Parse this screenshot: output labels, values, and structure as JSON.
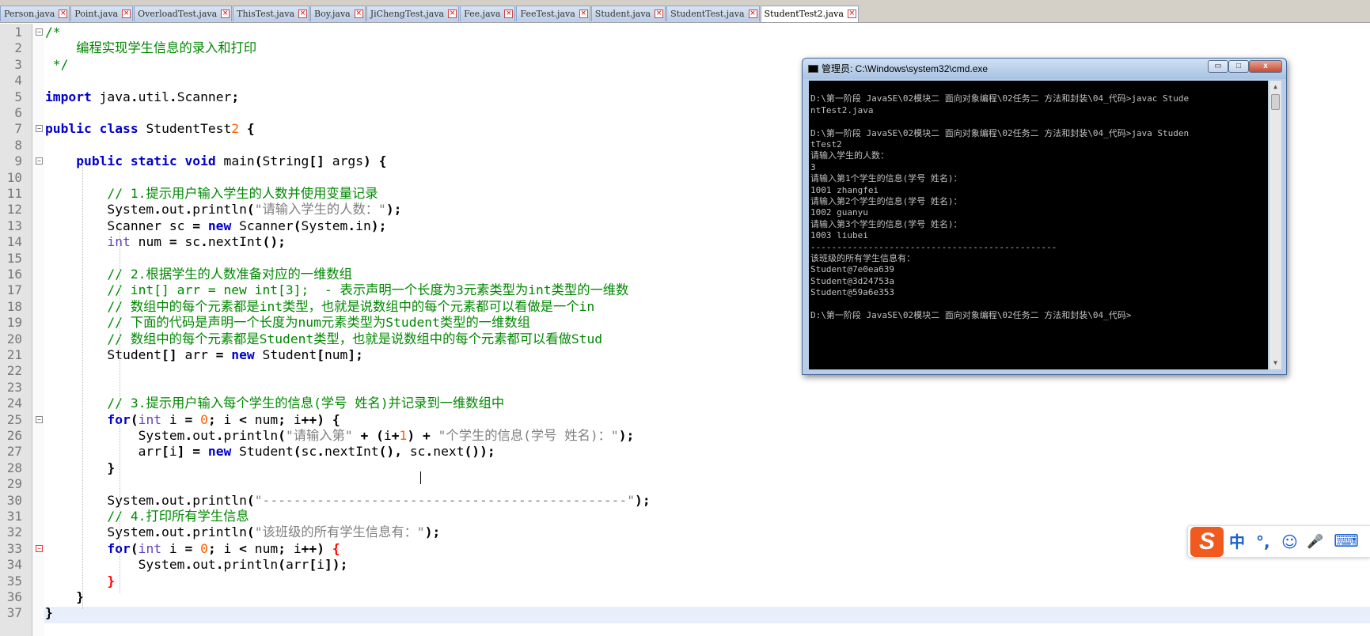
{
  "tabs": [
    {
      "label": "Person.java",
      "active": false
    },
    {
      "label": "Point.java",
      "active": false
    },
    {
      "label": "OverloadTest.java",
      "active": false
    },
    {
      "label": "ThisTest.java",
      "active": false
    },
    {
      "label": "Boy.java",
      "active": false
    },
    {
      "label": "JiChengTest.java",
      "active": false
    },
    {
      "label": "Fee.java",
      "active": false
    },
    {
      "label": "FeeTest.java",
      "active": false
    },
    {
      "label": "Student.java",
      "active": false
    },
    {
      "label": "StudentTest.java",
      "active": false
    },
    {
      "label": "StudentTest2.java",
      "active": true
    }
  ],
  "editor": {
    "current_line": 35,
    "lines": [
      {
        "n": "1",
        "html": "/*"
      },
      {
        "n": "2",
        "html": "    编程实现学生信息的录入和打印"
      },
      {
        "n": "3",
        "html": " */"
      },
      {
        "n": "4",
        "html": ""
      },
      {
        "n": "5",
        "html": "import java.util.Scanner;"
      },
      {
        "n": "6",
        "html": ""
      },
      {
        "n": "7",
        "html": "public class StudentTest2 {"
      },
      {
        "n": "8",
        "html": ""
      },
      {
        "n": "9",
        "html": "    public static void main(String[] args) {"
      },
      {
        "n": "10",
        "html": ""
      },
      {
        "n": "11",
        "html": "        // 1.提示用户输入学生的人数并使用变量记录"
      },
      {
        "n": "12",
        "html": "        System.out.println(\"请输入学生的人数：\");"
      },
      {
        "n": "13",
        "html": "        Scanner sc = new Scanner(System.in);"
      },
      {
        "n": "14",
        "html": "        int num = sc.nextInt();"
      },
      {
        "n": "15",
        "html": ""
      },
      {
        "n": "16",
        "html": "        // 2.根据学生的人数准备对应的一维数组"
      },
      {
        "n": "17",
        "html": "        // int[] arr = new int[3];  - 表示声明一个长度为3元素类型为int类型的一维数"
      },
      {
        "n": "18",
        "html": "        // 数组中的每个元素都是int类型，也就是说数组中的每个元素都可以看做是一个in"
      },
      {
        "n": "19",
        "html": "        // 下面的代码是声明一个长度为num元素类型为Student类型的一维数组"
      },
      {
        "n": "20",
        "html": "        // 数组中的每个元素都是Student类型，也就是说数组中的每个元素都可以看做Stud"
      },
      {
        "n": "21",
        "html": "        Student[] arr = new Student[num];"
      },
      {
        "n": "22",
        "html": ""
      },
      {
        "n": "23",
        "html": ""
      },
      {
        "n": "24",
        "html": "        // 3.提示用户输入每个学生的信息(学号 姓名)并记录到一维数组中"
      },
      {
        "n": "25",
        "html": "        for(int i = 0; i < num; i++) {"
      },
      {
        "n": "26",
        "html": "            System.out.println(\"请输入第\" + (i+1) + \"个学生的信息(学号 姓名)：\");"
      },
      {
        "n": "27",
        "html": "            arr[i] = new Student(sc.nextInt(), sc.next());"
      },
      {
        "n": "28",
        "html": "        }"
      },
      {
        "n": "29",
        "html": ""
      },
      {
        "n": "30",
        "html": "        System.out.println(\"-----------------------------------------------\");"
      },
      {
        "n": "31",
        "html": "        // 4.打印所有学生信息"
      },
      {
        "n": "32",
        "html": "        System.out.println(\"该班级的所有学生信息有：\");"
      },
      {
        "n": "33",
        "html": "        for(int i = 0; i < num; i++) {"
      },
      {
        "n": "34",
        "html": "            System.out.println(arr[i]);"
      },
      {
        "n": "35",
        "html": "        }"
      },
      {
        "n": "36",
        "html": "    }"
      },
      {
        "n": "37",
        "html": "}"
      }
    ]
  },
  "cmd": {
    "title": "管理员: C:\\Windows\\system32\\cmd.exe",
    "min_glyph": "▭",
    "max_glyph": "□",
    "close_glyph": "x",
    "scroll_up": "▲",
    "scroll_down": "▼",
    "lines": [
      "",
      "D:\\第一阶段 JavaSE\\02模块二 面向对象编程\\02任务二 方法和封装\\04_代码>javac Stude",
      "ntTest2.java",
      "",
      "D:\\第一阶段 JavaSE\\02模块二 面向对象编程\\02任务二 方法和封装\\04_代码>java Studen",
      "tTest2",
      "请输入学生的人数：",
      "3",
      "请输入第1个学生的信息(学号 姓名)：",
      "1001 zhangfei",
      "请输入第2个学生的信息(学号 姓名)：",
      "1002 guanyu",
      "请输入第3个学生的信息(学号 姓名)：",
      "1003 liubei",
      "-----------------------------------------------",
      "该班级的所有学生信息有：",
      "Student@7e0ea639",
      "Student@3d24753a",
      "Student@59a6e353",
      "",
      "D:\\第一阶段 JavaSE\\02模块二 面向对象编程\\02任务二 方法和封装\\04_代码>"
    ]
  },
  "ime": {
    "logo": "S",
    "mode": "中",
    "punct": "°,",
    "emoji": "☺",
    "mic": "🎤",
    "keyboard": "⌨"
  }
}
